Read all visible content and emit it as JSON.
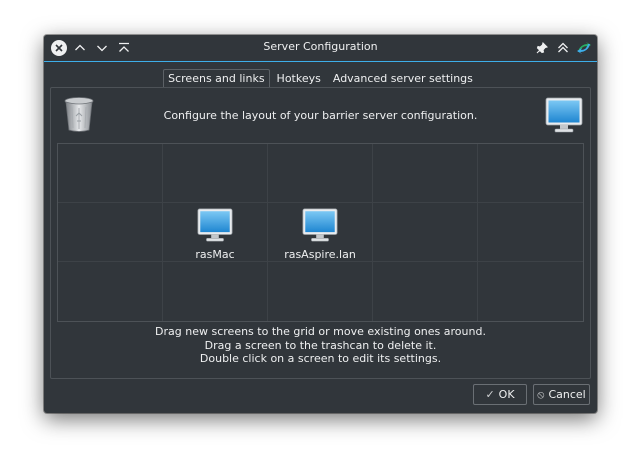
{
  "window": {
    "title": "Server Configuration"
  },
  "titlebar": {
    "close_icon": "close-icon",
    "minimize_icon": "chevron-up-icon",
    "restore_icon": "chevron-down-icon",
    "shade_icon": "keep-top-icon",
    "pin_icon": "pin-icon",
    "keep_above_icon": "keep-above-icon",
    "app_icon": "barrier-app-icon"
  },
  "tabs": [
    {
      "label": "Screens and links",
      "active": true
    },
    {
      "label": "Hotkeys",
      "active": false
    },
    {
      "label": "Advanced server settings",
      "active": false
    }
  ],
  "screens_tab": {
    "header": "Configure the layout of your barrier server configuration.",
    "trash_icon": "trashcan-icon",
    "new_screen_icon": "monitor-icon",
    "grid": {
      "columns": 5,
      "rows": 3,
      "screens": [
        {
          "name": "rasMac",
          "row": 1,
          "col": 1
        },
        {
          "name": "rasAspire.lan",
          "row": 1,
          "col": 2
        }
      ]
    },
    "instructions": [
      "Drag new screens to the grid or move existing ones around.",
      "Drag a screen to the trashcan to delete it.",
      "Double click on a screen to edit its settings."
    ]
  },
  "buttons": {
    "ok": "OK",
    "cancel": "Cancel"
  },
  "colors": {
    "window_bg": "#31363b",
    "accent": "#3daee9",
    "text": "#eff0f1"
  }
}
